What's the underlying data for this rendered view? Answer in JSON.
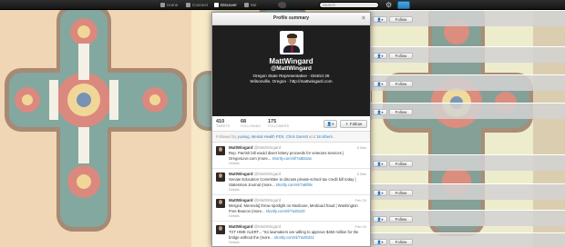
{
  "topbar": {
    "nav": [
      {
        "label": "Home",
        "icon": "home-icon"
      },
      {
        "label": "Connect",
        "icon": "at-icon"
      },
      {
        "label": "Discover",
        "icon": "hash-icon"
      },
      {
        "label": "Me",
        "icon": "person-icon"
      }
    ],
    "search_placeholder": "Search",
    "gear_glyph": "⚙"
  },
  "side_follow": {
    "user_glyph": "👤▾",
    "follow_label": "Follow"
  },
  "modal": {
    "title": "Profile summary",
    "close_glyph": "×",
    "profile": {
      "name": "MattWingard",
      "handle": "@MattWingard",
      "bio": "Oregon State Representative - District 26",
      "location": "Wilsonville, Oregon",
      "separator": "·",
      "url": "http://mattwingard.com"
    },
    "stats": [
      {
        "value": "410",
        "label": "TWEETS"
      },
      {
        "value": "68",
        "label": "FOLLOWING"
      },
      {
        "value": "175",
        "label": "FOLLOWERS"
      }
    ],
    "user_button": "👤▾",
    "follow_button": "Follow",
    "followed_by": {
      "prefix": "Followed by",
      "users": [
        "yuxiing",
        "Mental Health PDX",
        "Chris Garrett"
      ],
      "sep1": ",",
      "sep2": ",",
      "and": "and",
      "others": "18 others."
    },
    "tweets": [
      {
        "name": "MattWingard",
        "screen": "@MattWingard",
        "date": "6 Mar",
        "text": "Rep. Parrish bill would divert lottery proceeds for veterans services | OregonLive.com (more...",
        "link": "shortly.com/nl/7a8Ddas",
        "details": "Details"
      },
      {
        "name": "MattWingard",
        "screen": "@MattWingard",
        "date": "6 Mar",
        "text": "Senate Education Committee to discuss private-school tax credit bill today | Statesman Journal (more...",
        "link": "shortly.com/nl/7a8f8lx",
        "details": "Details"
      },
      {
        "name": "MattWingard",
        "screen": "@MattWingard",
        "date": "Feb 20",
        "text": "Merged, Merenda] throw spotlight on Medicare, Medicaid fraud | Washington Free Beacon (more...",
        "link": "shortly.com/nl/7a25100",
        "details": "Details"
      },
      {
        "name": "MattWingard",
        "screen": "@MattWingard",
        "date": "Feb 20",
        "text": "TXT HWE ALERT... \"So lawmakers are willing to approve $450 million for the bridge without the (more...",
        "link": "shortly.com/nl/7a2l9322",
        "details": "Details"
      }
    ]
  },
  "colors": {
    "topbar": "#1a1a1a",
    "cover": "#1f1f1f",
    "link": "#2a7fc0",
    "follow_bird": "#2a9ed8"
  }
}
